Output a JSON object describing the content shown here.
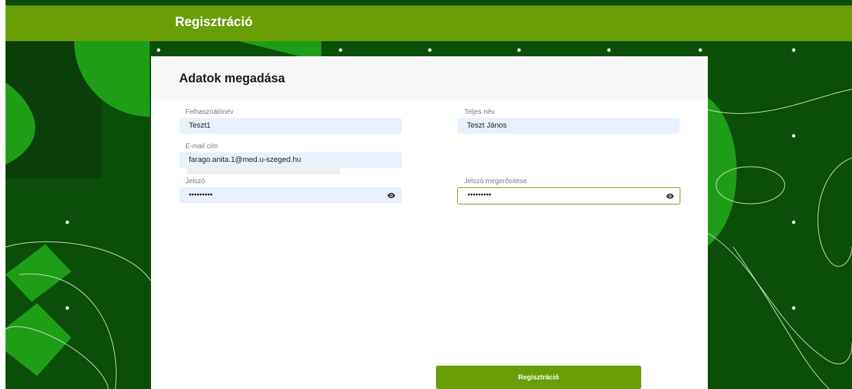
{
  "header": {
    "title": "Regisztráció"
  },
  "card": {
    "title": "Adatok megadása"
  },
  "form": {
    "username": {
      "label": "Felhasználónév",
      "value": "Teszt1"
    },
    "fullname": {
      "label": "Teljes név",
      "value": "Teszt János"
    },
    "email": {
      "label": "E-mail cím",
      "value": "farago.anita.1@med.u-szeged.hu"
    },
    "password": {
      "label": "Jelszó",
      "value": "•••••••••"
    },
    "password_confirm": {
      "label": "Jelszó megerősítése",
      "value": "•••••••••"
    }
  },
  "submit_label": "Regisztráció",
  "colors": {
    "header": "#6a9e07",
    "background": "#0b4e0a",
    "accent_green": "#1e9e17",
    "button": "#6a9e07"
  },
  "icons": {
    "password_toggle": "eye-icon"
  }
}
